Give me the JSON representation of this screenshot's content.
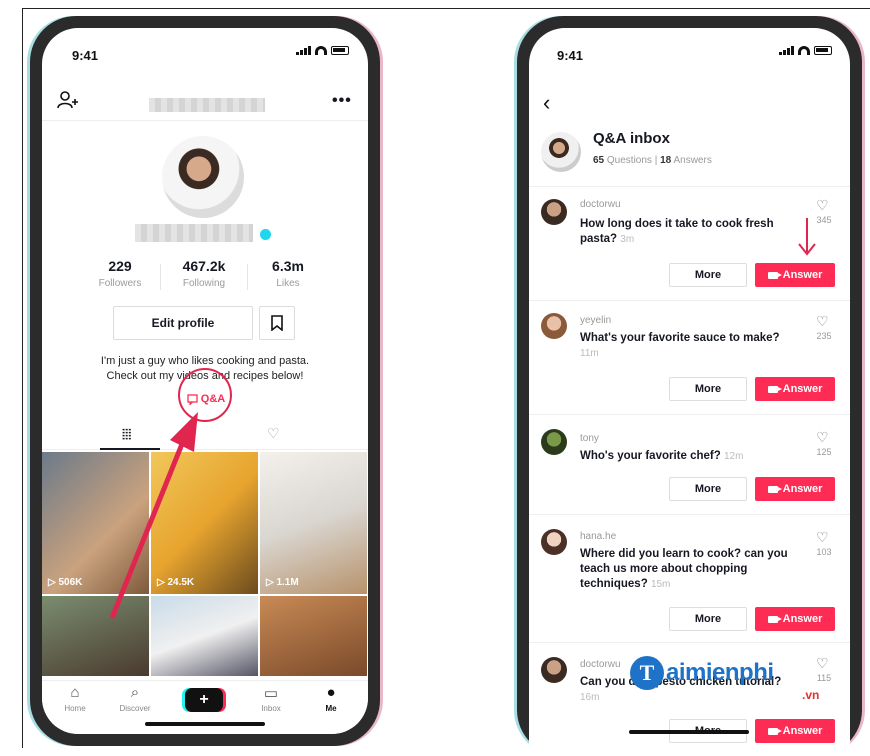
{
  "left": {
    "status_time": "9:41",
    "stats": [
      {
        "value": "229",
        "label": "Followers"
      },
      {
        "value": "467.2k",
        "label": "Following"
      },
      {
        "value": "6.3m",
        "label": "Likes"
      }
    ],
    "edit_profile": "Edit profile",
    "bio_line1": "I'm just a guy who likes cooking and pasta.",
    "bio_line2": "Check out my videos and recipes below!",
    "qa_link": "Q&A",
    "grid_views": [
      "506K",
      "24.5K",
      "1.1M"
    ],
    "nav": [
      {
        "label": "Home",
        "icon": "home-icon"
      },
      {
        "label": "Discover",
        "icon": "search-icon"
      },
      {
        "label": "+",
        "icon": "plus-icon"
      },
      {
        "label": "Inbox",
        "icon": "inbox-icon"
      },
      {
        "label": "Me",
        "icon": "person-icon"
      }
    ]
  },
  "right": {
    "status_time": "9:41",
    "title": "Q&A inbox",
    "questions_count": "65",
    "questions_label": "Questions",
    "answers_count": "18",
    "answers_label": "Answers",
    "more_label": "More",
    "answer_label": "Answer",
    "items": [
      {
        "user": "doctorwu",
        "text": "How long does it take to cook fresh pasta?",
        "time": "3m",
        "likes": "345"
      },
      {
        "user": "yeyelin",
        "text": "What's your favorite sauce to make?",
        "time": "11m",
        "likes": "235"
      },
      {
        "user": "tony",
        "text": "Who's your favorite chef?",
        "time": "12m",
        "likes": "125"
      },
      {
        "user": "hana.he",
        "text": "Where did you learn to cook? can you teach us more about chopping techniques?",
        "time": "15m",
        "likes": "103"
      },
      {
        "user": "doctorwu",
        "text": "Can you do a pesto chicken tutorial?",
        "time": "16m",
        "likes": "115"
      }
    ]
  },
  "watermark": {
    "letter": "T",
    "text": "aimienphi",
    "tld": ".vn"
  },
  "colors": {
    "accent": "#fe2c55",
    "annotation": "#e0264f",
    "watermark": "#1e73c9"
  }
}
